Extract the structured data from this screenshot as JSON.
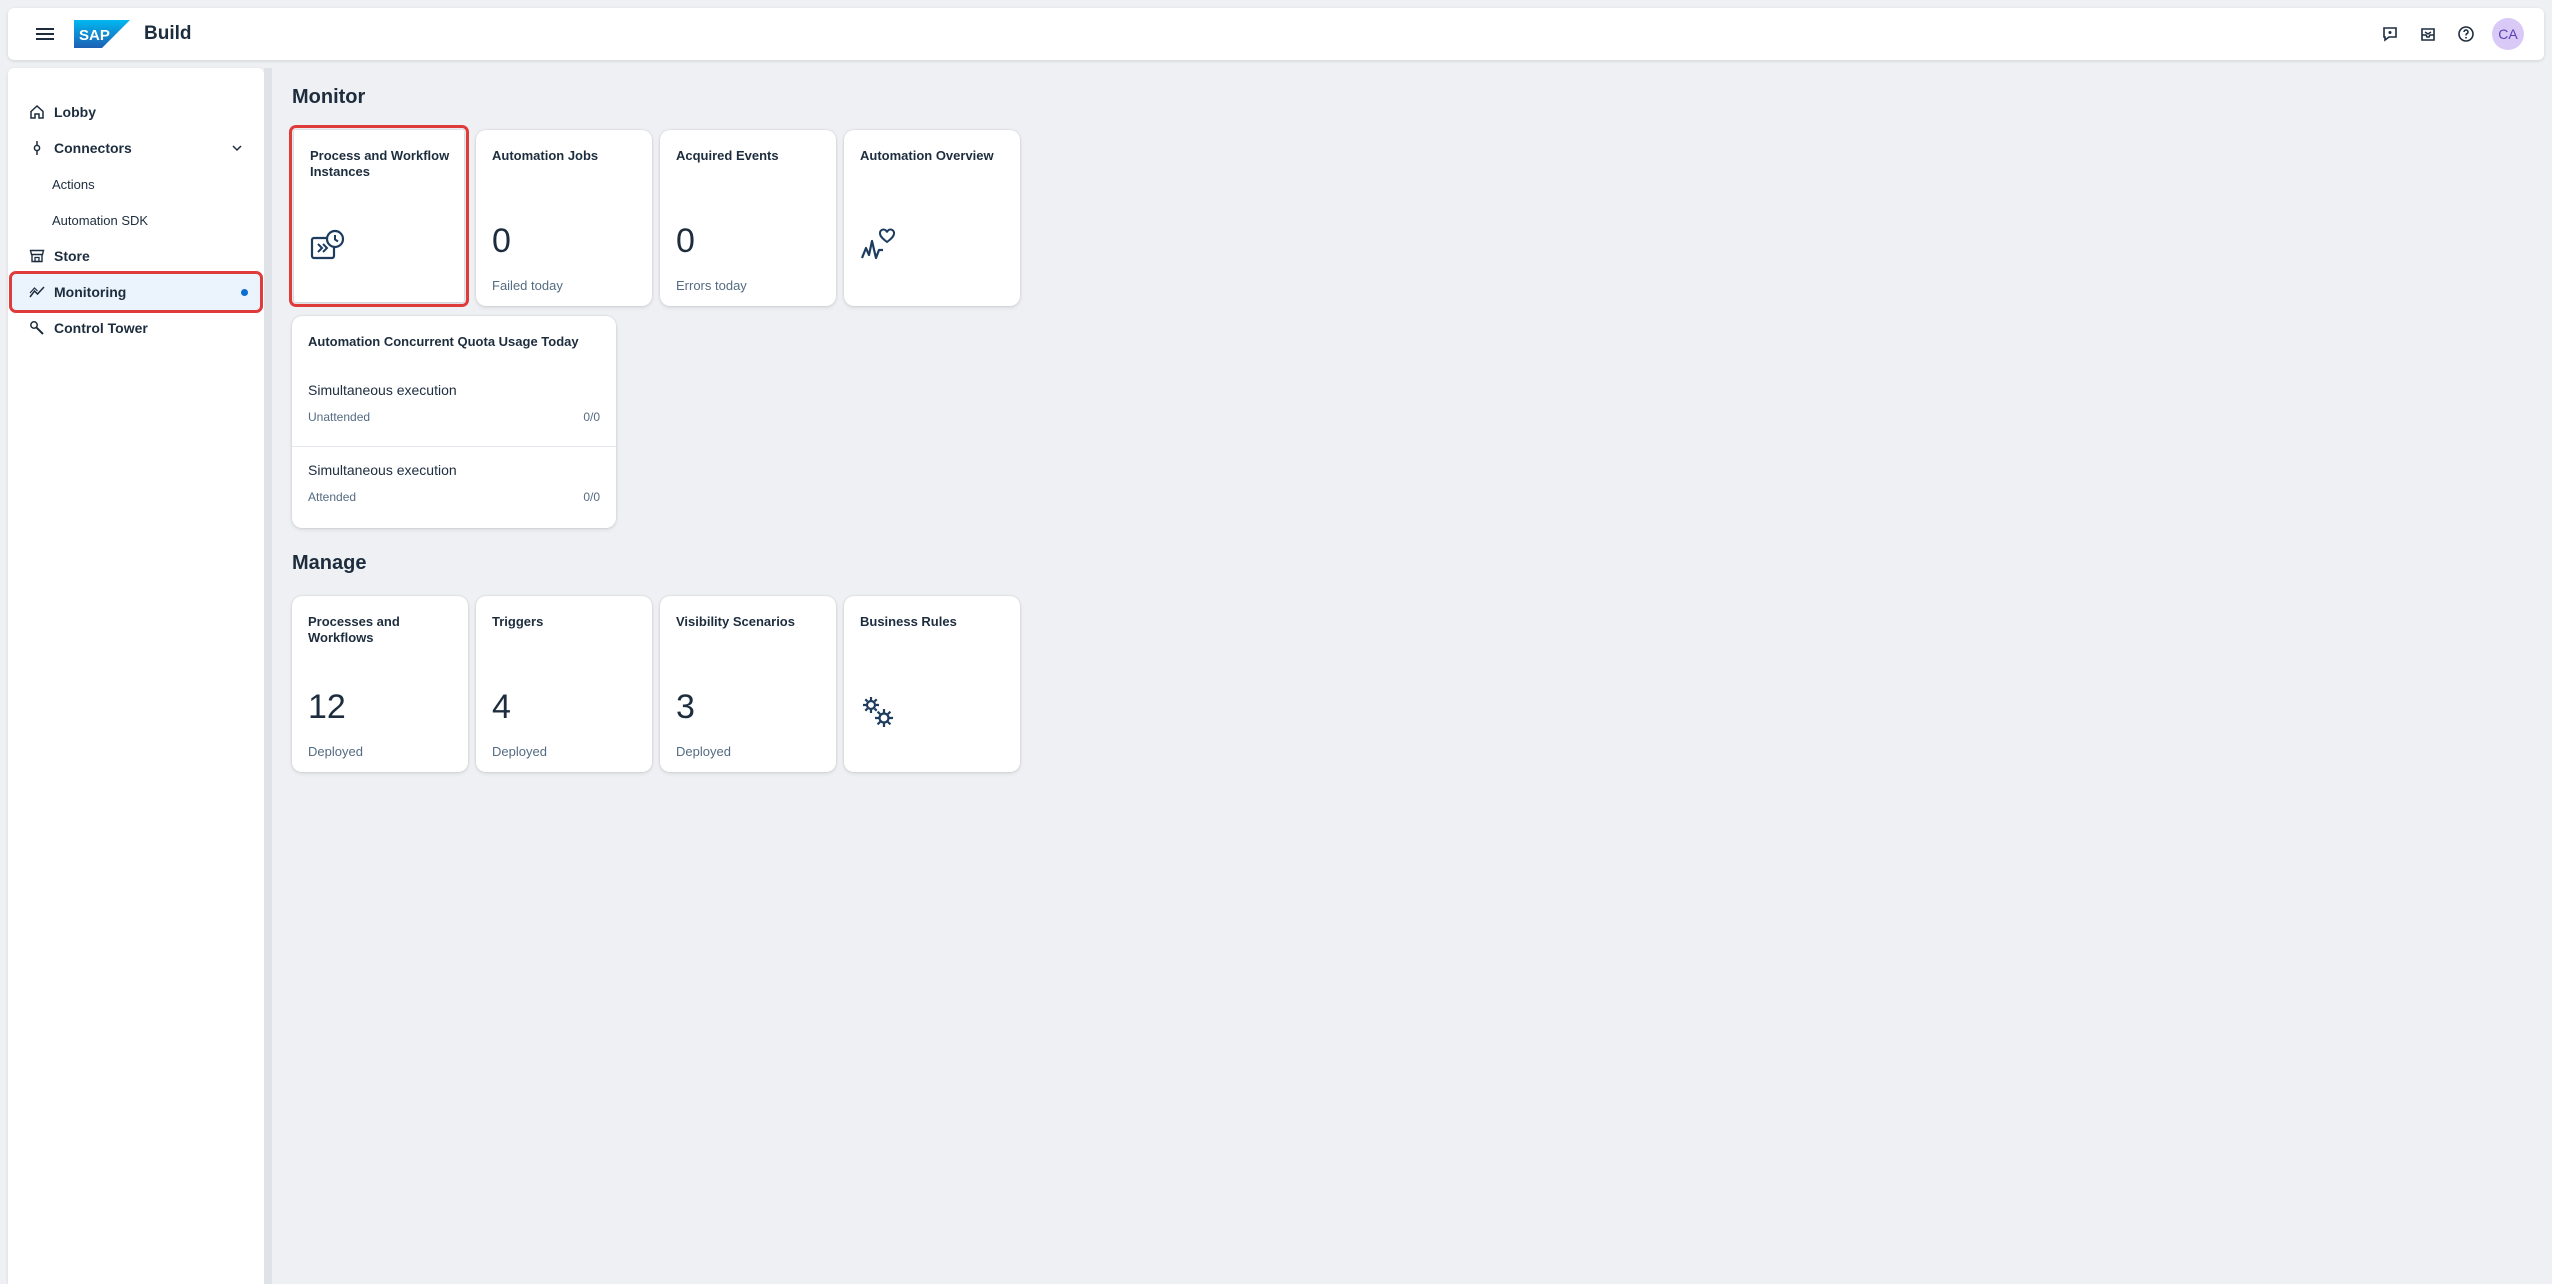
{
  "shell": {
    "brand_logo_text": "SAP",
    "title": "Build",
    "avatar_initials": "CA"
  },
  "sidenav": {
    "items": [
      {
        "label": "Lobby",
        "icon": "home-icon"
      },
      {
        "label": "Connectors",
        "icon": "connector-icon",
        "expanded": true
      },
      {
        "label": "Actions"
      },
      {
        "label": "Automation SDK"
      },
      {
        "label": "Store",
        "icon": "store-icon"
      },
      {
        "label": "Monitoring",
        "icon": "line-chart-icon",
        "selected": true
      },
      {
        "label": "Control Tower",
        "icon": "wrench-icon"
      }
    ]
  },
  "monitor": {
    "title": "Monitor",
    "tiles": [
      {
        "title": "Process and Workflow Instances",
        "icon": "process-clock-icon"
      },
      {
        "title": "Automation Jobs",
        "number": "0",
        "footer": "Failed today"
      },
      {
        "title": "Acquired Events",
        "number": "0",
        "footer": "Errors today"
      },
      {
        "title": "Automation Overview",
        "icon": "heart-pulse-icon"
      }
    ],
    "quota": {
      "title": "Automation Concurrent Quota Usage Today",
      "rows": [
        {
          "label": "Simultaneous execution",
          "sub": "Unattended",
          "value": "0/0"
        },
        {
          "label": "Simultaneous execution",
          "sub": "Attended",
          "value": "0/0"
        }
      ]
    }
  },
  "manage": {
    "title": "Manage",
    "tiles": [
      {
        "title": "Processes and Workflows",
        "number": "12",
        "footer": "Deployed"
      },
      {
        "title": "Triggers",
        "number": "4",
        "footer": "Deployed"
      },
      {
        "title": "Visibility Scenarios",
        "number": "3",
        "footer": "Deployed"
      },
      {
        "title": "Business Rules",
        "icon": "gears-icon"
      }
    ]
  },
  "colors": {
    "accent": "#0a6ed1",
    "highlight": "#e03b3b",
    "sap_blue": "#1b8be0"
  }
}
